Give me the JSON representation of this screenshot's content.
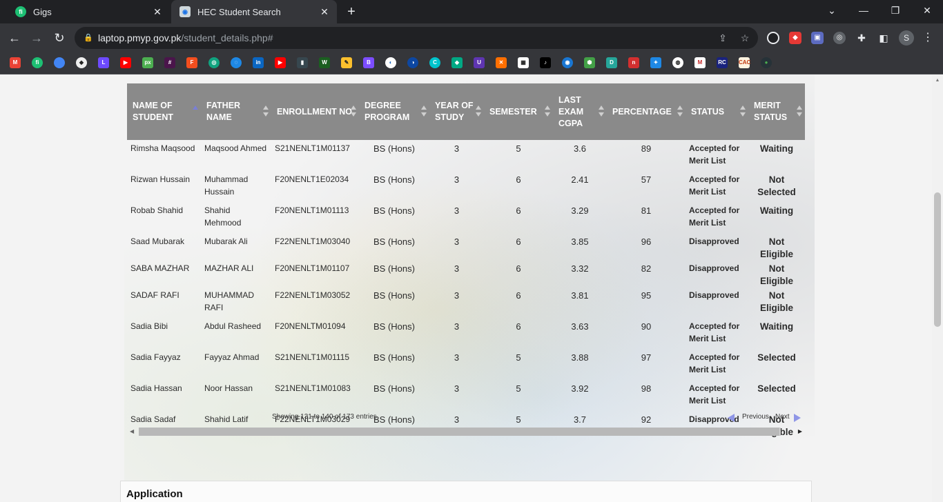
{
  "browser": {
    "tabs": [
      {
        "title": "Gigs",
        "favicon": "fiverr-icon"
      },
      {
        "title": "HEC Student Search",
        "favicon": "site-icon"
      }
    ],
    "url_host": "laptop.pmyp.gov.pk",
    "url_path": "/student_details.php#",
    "profile_initial": "S"
  },
  "table": {
    "columns": [
      "NAME OF STUDENT",
      "FATHER NAME",
      "ENROLLMENT NO",
      "DEGREE PROGRAM",
      "YEAR OF STUDY",
      "SEMESTER",
      "LAST EXAM CGPA",
      "PERCENTAGE",
      "STATUS",
      "MERIT STATUS"
    ],
    "rows": [
      {
        "name": "Rimsha Maqsood",
        "father": "Maqsood Ahmed",
        "enrollment": "S21NENLT1M01137",
        "degree": "BS (Hons)",
        "year": "3",
        "semester": "5",
        "cgpa": "3.6",
        "percentage": "89",
        "status": "Accepted for Merit List",
        "merit": "Waiting"
      },
      {
        "name": "Rizwan Hussain",
        "father": "Muhammad Hussain",
        "enrollment": "F20NENLT1E02034",
        "degree": "BS (Hons)",
        "year": "3",
        "semester": "6",
        "cgpa": "2.41",
        "percentage": "57",
        "status": "Accepted for Merit List",
        "merit": "Not Selected"
      },
      {
        "name": "Robab Shahid",
        "father": "Shahid Mehmood",
        "enrollment": "F20NENLT1M01113",
        "degree": "BS (Hons)",
        "year": "3",
        "semester": "6",
        "cgpa": "3.29",
        "percentage": "81",
        "status": "Accepted for Merit List",
        "merit": "Waiting"
      },
      {
        "name": "Saad Mubarak",
        "father": "Mubarak Ali",
        "enrollment": "F22NENLT1M03040",
        "degree": "BS (Hons)",
        "year": "3",
        "semester": "6",
        "cgpa": "3.85",
        "percentage": "96",
        "status": "Disapproved",
        "merit": "Not Eligible"
      },
      {
        "name": "SABA MAZHAR",
        "father": "MAZHAR ALI",
        "enrollment": "F20NENLT1M01107",
        "degree": "BS (Hons)",
        "year": "3",
        "semester": "6",
        "cgpa": "3.32",
        "percentage": "82",
        "status": "Disapproved",
        "merit": "Not Eligible"
      },
      {
        "name": "SADAF RAFI",
        "father": "MUHAMMAD RAFI",
        "enrollment": "F22NENLT1M03052",
        "degree": "BS (Hons)",
        "year": "3",
        "semester": "6",
        "cgpa": "3.81",
        "percentage": "95",
        "status": "Disapproved",
        "merit": "Not Eligible"
      },
      {
        "name": "Sadia Bibi",
        "father": "Abdul Rasheed",
        "enrollment": "F20NENLTM01094",
        "degree": "BS (Hons)",
        "year": "3",
        "semester": "6",
        "cgpa": "3.63",
        "percentage": "90",
        "status": "Accepted for Merit List",
        "merit": "Waiting"
      },
      {
        "name": "Sadia Fayyaz",
        "father": "Fayyaz Ahmad",
        "enrollment": "S21NENLT1M01115",
        "degree": "BS (Hons)",
        "year": "3",
        "semester": "5",
        "cgpa": "3.88",
        "percentage": "97",
        "status": "Accepted for Merit List",
        "merit": "Selected"
      },
      {
        "name": "Sadia Hassan",
        "father": "Noor Hassan",
        "enrollment": "S21NENLT1M01083",
        "degree": "BS (Hons)",
        "year": "3",
        "semester": "5",
        "cgpa": "3.92",
        "percentage": "98",
        "status": "Accepted for Merit List",
        "merit": "Selected"
      },
      {
        "name": "Sadia Sadaf",
        "father": "Shahid Latif",
        "enrollment": "F22NENLT1M03029",
        "degree": "BS (Hons)",
        "year": "3",
        "semester": "5",
        "cgpa": "3.7",
        "percentage": "92",
        "status": "Disapproved",
        "merit": "Not Eligible"
      }
    ],
    "info": "Showing 131 to 140 of 173 entries",
    "prev_label": "Previous",
    "next_label": "Next"
  },
  "application": {
    "title": "Application"
  },
  "colors": {
    "header_bg": "#8a8a8a",
    "accepted": "#e8590c",
    "waiting": "#2a8ccf",
    "not_eligible": "#e03131",
    "selected": "#7b3fa2"
  }
}
